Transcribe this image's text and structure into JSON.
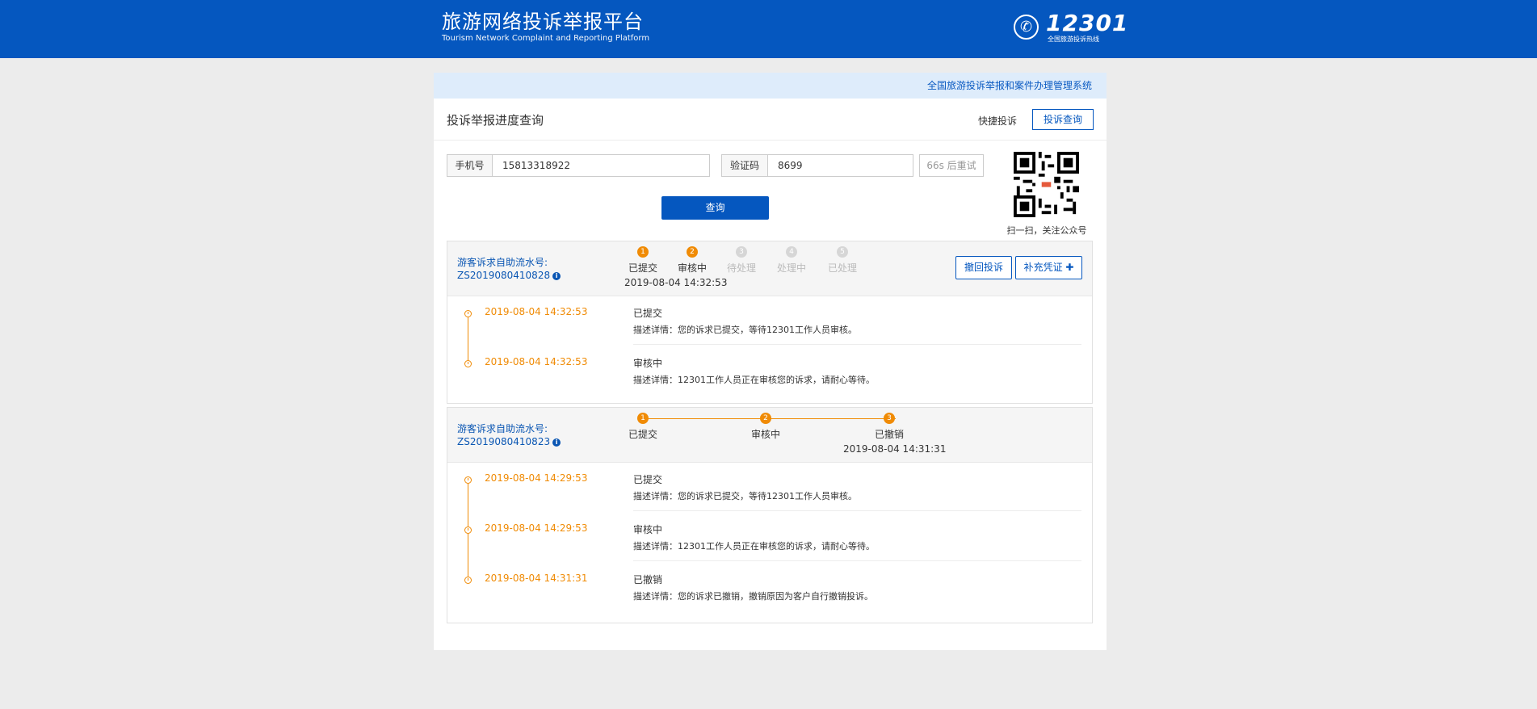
{
  "header": {
    "title_cn": "旅游网络投诉举报平台",
    "title_en": "Tourism Network Complaint and Reporting Platform",
    "hotline_number": "12301",
    "hotline_sub": "全国旅游投诉热线",
    "hotline_icon": "phone-icon"
  },
  "system_name": "全国旅游投诉举报和案件办理管理系统",
  "page": {
    "title": "投诉举报进度查询",
    "quick_complaint": "快捷投诉",
    "complaint_query": "投诉查询"
  },
  "form": {
    "phone_label": "手机号",
    "phone_value": "15813318922",
    "code_label": "验证码",
    "code_value": "8699",
    "retry_label": "66s 后重试",
    "search_button": "查询"
  },
  "qr": {
    "caption": "扫一扫，关注公众号",
    "icon": "qr-code-icon"
  },
  "cases": [
    {
      "serial_label": "游客诉求自助流水号:",
      "serial_no": "ZS2019080410828",
      "steps": [
        {
          "num": "1",
          "label": "已提交",
          "done": true
        },
        {
          "num": "2",
          "label": "审核中",
          "done": true
        },
        {
          "num": "3",
          "label": "待处理",
          "done": false
        },
        {
          "num": "4",
          "label": "处理中",
          "done": false
        },
        {
          "num": "5",
          "label": "已处理",
          "done": false
        }
      ],
      "current_time": "2019-08-04 14:32:53",
      "buttons": {
        "withdraw": "撤回投诉",
        "supplement": "补充凭证 ✚"
      },
      "logs": [
        {
          "time": "2019-08-04 14:32:53",
          "status": "已提交",
          "desc": "描述详情：您的诉求已提交，等待12301工作人员审核。"
        },
        {
          "time": "2019-08-04 14:32:53",
          "status": "审核中",
          "desc": "描述详情：12301工作人员正在审核您的诉求，请耐心等待。"
        }
      ]
    },
    {
      "serial_label": "游客诉求自助流水号:",
      "serial_no": "ZS2019080410823",
      "steps": [
        {
          "num": "1",
          "label": "已提交",
          "done": true
        },
        {
          "num": "2",
          "label": "审核中",
          "done": true
        },
        {
          "num": "3",
          "label": "已撤销",
          "done": true
        }
      ],
      "current_time": "2019-08-04 14:31:31",
      "logs": [
        {
          "time": "2019-08-04 14:29:53",
          "status": "已提交",
          "desc": "描述详情：您的诉求已提交，等待12301工作人员审核。"
        },
        {
          "time": "2019-08-04 14:29:53",
          "status": "审核中",
          "desc": "描述详情：12301工作人员正在审核您的诉求，请耐心等待。"
        },
        {
          "time": "2019-08-04 14:31:31",
          "status": "已撤销",
          "desc": "描述详情：您的诉求已撤销，撤销原因为客户自行撤销投诉。"
        }
      ]
    }
  ],
  "colors": {
    "brand_blue": "#0557bf",
    "progress_orange": "#f08b05",
    "inactive_gray": "#d6d6d6"
  }
}
